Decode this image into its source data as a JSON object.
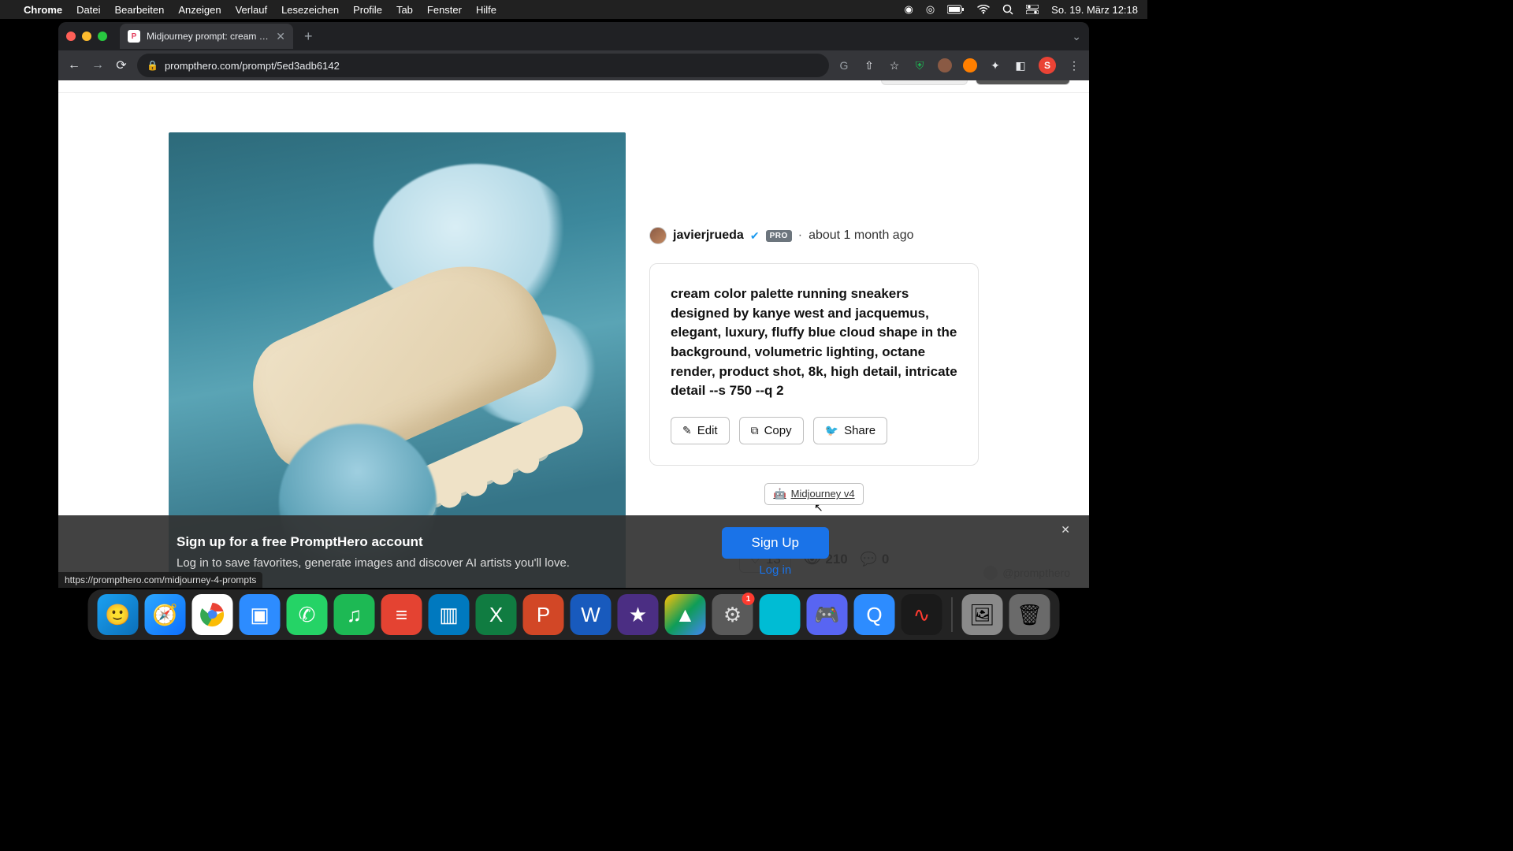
{
  "menubar": {
    "app": "Chrome",
    "items": [
      "Datei",
      "Bearbeiten",
      "Anzeigen",
      "Verlauf",
      "Lesezeichen",
      "Profile",
      "Tab",
      "Fenster",
      "Hilfe"
    ],
    "clock": "So. 19. März  12:18"
  },
  "browser": {
    "tab_title": "Midjourney prompt: cream col…",
    "url": "prompthero.com/prompt/5ed3adb6142",
    "status_url": "https://prompthero.com/midjourney-4-prompts",
    "avatar_letter": "S"
  },
  "author": {
    "name": "javierjrueda",
    "pro": "PRO",
    "timeago": "about 1 month ago"
  },
  "prompt": {
    "text": "cream color palette running sneakers designed by kanye west and jacquemus, elegant, luxury, fluffy blue cloud shape in the background, volumetric lighting, octane render, product shot, 8k, high detail, intricate detail --s 750 --q 2",
    "actions": {
      "edit": "Edit",
      "copy": "Copy",
      "share": "Share"
    },
    "model": "Midjourney v4"
  },
  "stats": {
    "likes": "13",
    "views": "210",
    "comments": "0"
  },
  "share_label": "Sh",
  "handle": "@prompthero",
  "banner": {
    "title": "Sign up for a free PromptHero account",
    "sub": "Log in to save favorites, generate images and discover AI artists you'll love.",
    "signup": "Sign Up",
    "login": "Log in"
  },
  "dock": {
    "settings_badge": "1"
  }
}
